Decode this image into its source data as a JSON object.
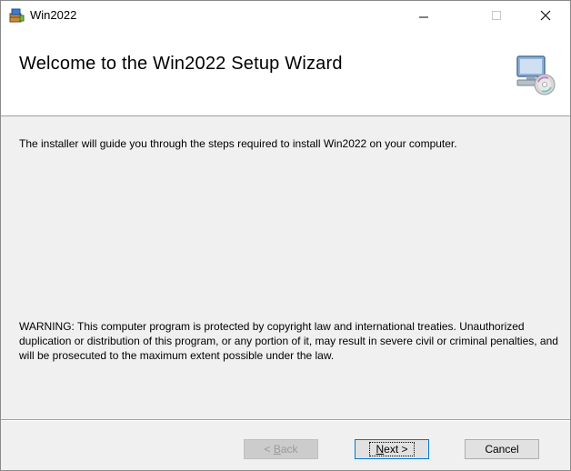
{
  "window": {
    "title": "Win2022",
    "app_icon": "installer-package-icon",
    "controls": {
      "minimize": "minimize-icon",
      "maximize": "maximize-icon",
      "close": "close-icon"
    }
  },
  "header": {
    "title": "Welcome to the Win2022 Setup Wizard",
    "image": "computer-cd-icon"
  },
  "body": {
    "intro": "The installer will guide you through the steps required to install Win2022 on your computer.",
    "warning": "WARNING: This computer program is protected by copyright law and international treaties. Unauthorized duplication or distribution of this program, or any portion of it, may result in severe civil or criminal penalties, and will be prosecuted to the maximum extent possible under the law."
  },
  "buttons": {
    "back": {
      "prefix": "< ",
      "accel": "B",
      "rest": "ack",
      "enabled": false
    },
    "next": {
      "accel": "N",
      "rest": "ext >",
      "enabled": true
    },
    "cancel": {
      "label": "Cancel",
      "enabled": true
    }
  }
}
